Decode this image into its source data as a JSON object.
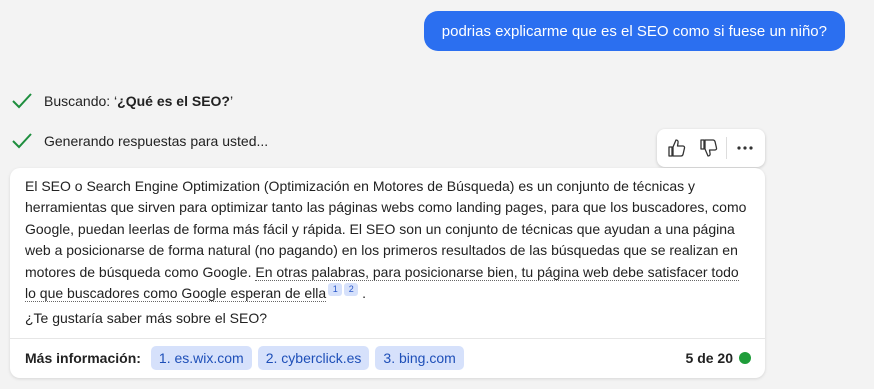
{
  "user_message": "podrias explicarme que es el SEO como si fuese un niño?",
  "status": {
    "searching_prefix": "Buscando: ‘",
    "searching_query": "¿Qué es el SEO?",
    "searching_suffix": "’",
    "generating": "Generando respuestas para usted..."
  },
  "answer": {
    "paragraph_plain": "El SEO o Search Engine Optimization (Optimización en Motores de Búsqueda) es un conjunto de técnicas y herramientas que sirven para optimizar tanto las páginas webs como landing pages, para que los buscadores, como Google, puedan leerlas de forma más fácil y rápida. El SEO son un conjunto de técnicas que ayudan a una página web a posicionarse de forma natural (no pagando) en los primeros resultados de las búsquedas que se realizan en motores de búsqueda como Google.",
    "paragraph_linked": "En otras palabras, para posicionarse bien, tu página web debe satisfacer todo lo que buscadores como Google esperan de ella",
    "citations": [
      "1",
      "2"
    ],
    "period": ".",
    "question": "¿Te gustaría saber más sobre el SEO?"
  },
  "more_info": {
    "label": "Más información:",
    "links": [
      "1. es.wix.com",
      "2. cyberclick.es",
      "3. bing.com"
    ]
  },
  "counter": "5 de 20",
  "colors": {
    "accent": "#2b6ff0",
    "chip_bg": "#d6e1fb",
    "status_dot": "#1f9d3a",
    "check": "#1e8e3e"
  },
  "icons": [
    "check-icon",
    "thumbs-up-icon",
    "thumbs-down-icon",
    "more-options-icon"
  ]
}
